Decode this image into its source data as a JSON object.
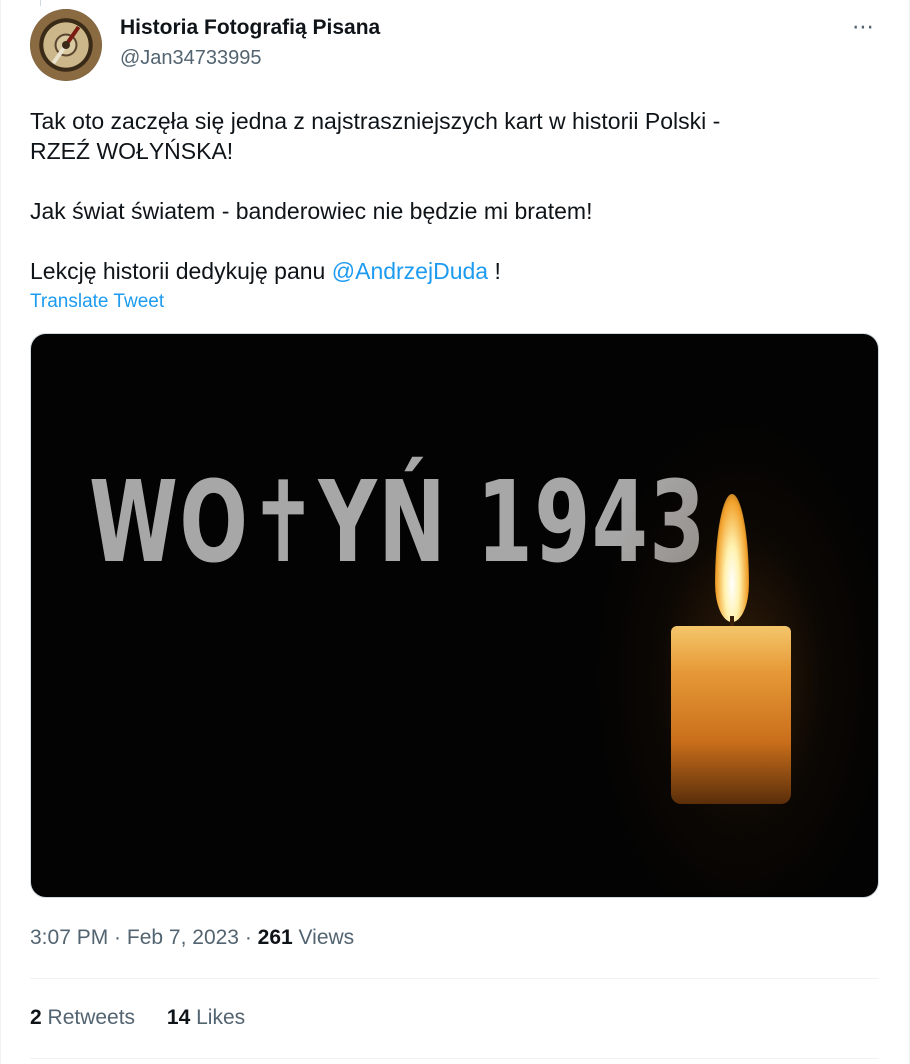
{
  "author": {
    "display_name": "Historia Fotografią Pisana",
    "handle": "@Jan34733995"
  },
  "more_icon": "⋯",
  "tweet": {
    "line1": "Tak oto zaczęła się jedna z najstraszniejszych kart w historii Polski -",
    "line2": "RZEŹ WOŁYŃSKA!",
    "line3": "Jak świat światem - banderowiec nie będzie mi bratem!",
    "line4_prefix": "Lekcję historii dedykuję panu ",
    "mention": "@AndrzejDuda",
    "line4_suffix": " !",
    "translate": "Translate Tweet"
  },
  "media": {
    "title": "WO✝YŃ 1943"
  },
  "meta": {
    "time": "3:07 PM",
    "separator": " · ",
    "date": "Feb 7, 2023",
    "views_count": "261",
    "views_label": " Views"
  },
  "stats": {
    "retweets_count": "2",
    "retweets_label": " Retweets",
    "likes_count": "14",
    "likes_label": " Likes"
  },
  "colors": {
    "link": "#1d9bf0",
    "secondary_text": "#536471",
    "primary_text": "#0f1419"
  }
}
